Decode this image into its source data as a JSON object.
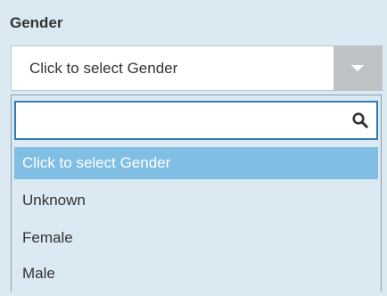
{
  "field": {
    "label": "Gender"
  },
  "select": {
    "value": "Click to select Gender",
    "arrow_icon": "chevron-down-icon"
  },
  "dropdown": {
    "search": {
      "value": "",
      "placeholder": "",
      "icon": "search-icon"
    },
    "options": [
      {
        "label": "Click to select Gender",
        "selected": true
      },
      {
        "label": "Unknown",
        "selected": false
      },
      {
        "label": "Female",
        "selected": false
      },
      {
        "label": "Male",
        "selected": false
      }
    ]
  },
  "colors": {
    "panel_bg": "#dbe9f3",
    "selected_bg": "#80bfe3",
    "focus_border": "#2f7ab7",
    "arrow_bg": "#bfc2c4"
  }
}
